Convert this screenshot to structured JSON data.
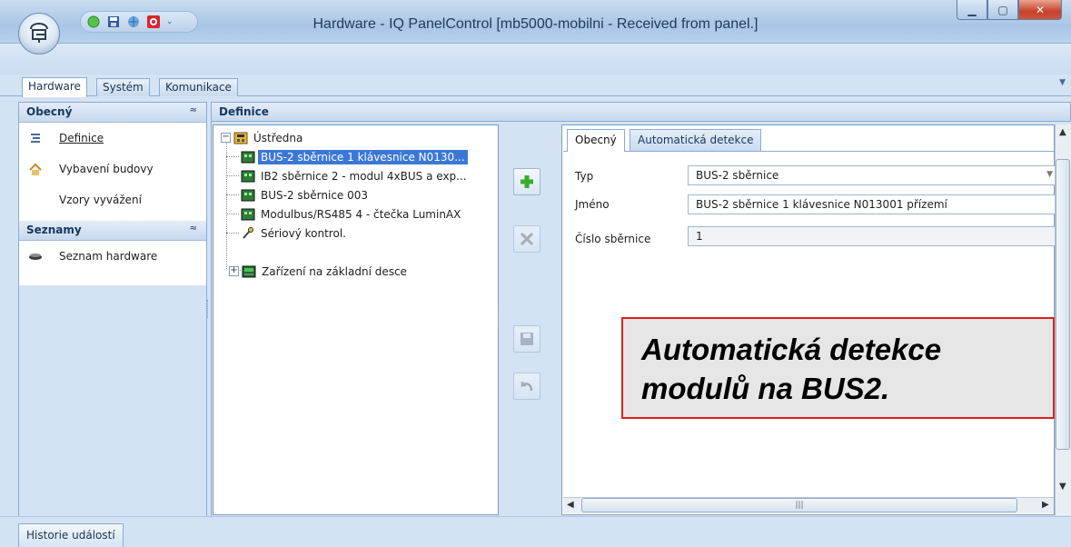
{
  "window": {
    "title": "Hardware - IQ PanelControl [mb5000-mobilni - Received from panel.]",
    "buttons": [
      "minimize-icon",
      "maximize-icon",
      "close-icon"
    ]
  },
  "quick_access": {
    "icons": [
      "status-green-icon",
      "save-icon",
      "network-icon",
      "alarm-icon",
      "dropdown-icon"
    ]
  },
  "main_tabs": [
    {
      "label": "Hardware",
      "active": true
    },
    {
      "label": "Systém",
      "active": false
    },
    {
      "label": "Komunikace",
      "active": false
    }
  ],
  "nav": {
    "section1": {
      "title": "Obecný",
      "items": [
        {
          "label": "Definice",
          "icon": "definition-icon",
          "link": true
        },
        {
          "label": "Vybavení budovy",
          "icon": "building-icon",
          "link": false
        },
        {
          "label": "Vzory vyvážení",
          "icon": "",
          "link": false
        }
      ]
    },
    "section2": {
      "title": "Seznamy",
      "items": [
        {
          "label": "Seznam hardware",
          "icon": "hardware-list-icon",
          "link": false
        }
      ]
    }
  },
  "definice": {
    "title": "Definice"
  },
  "tree": {
    "root": "Ústředna",
    "children": [
      {
        "label": "BUS-2 sběrnice 1 klávesnice N0130...",
        "selected": true
      },
      {
        "label": "IB2 sběrnice 2 - modul 4xBUS a exp...",
        "selected": false
      },
      {
        "label": "BUS-2 sběrnice 003",
        "selected": false
      },
      {
        "label": "Modulbus/RS485  4 - čtečka LuminAX",
        "selected": false
      },
      {
        "label": "Sériový kontrol.",
        "selected": false
      },
      {
        "label": "Zařízení na základní desce",
        "selected": false
      }
    ]
  },
  "actions": {
    "icons": [
      "add-icon",
      "delete-icon",
      "save-icon",
      "undo-icon"
    ]
  },
  "properties": {
    "tabs": [
      {
        "label": "Obecný",
        "active": true
      },
      {
        "label": "Automatická detekce",
        "active": false
      }
    ],
    "rows": [
      {
        "label": "Typ",
        "value": "BUS-2 sběrnice"
      },
      {
        "label": "Jméno",
        "value": "BUS-2 sběrnice 1 klávesnice N013001 přízemí"
      },
      {
        "label": "Číslo sběrnice",
        "value": "1"
      }
    ]
  },
  "callout": {
    "line1": "Automatická detekce",
    "line2": "modulů na BUS2."
  },
  "status": {
    "button": "Historie událostí"
  },
  "colors": {
    "accent": "#3b78d6",
    "panel_bg": "#d4e3f4",
    "callout_border": "#e0201e"
  }
}
